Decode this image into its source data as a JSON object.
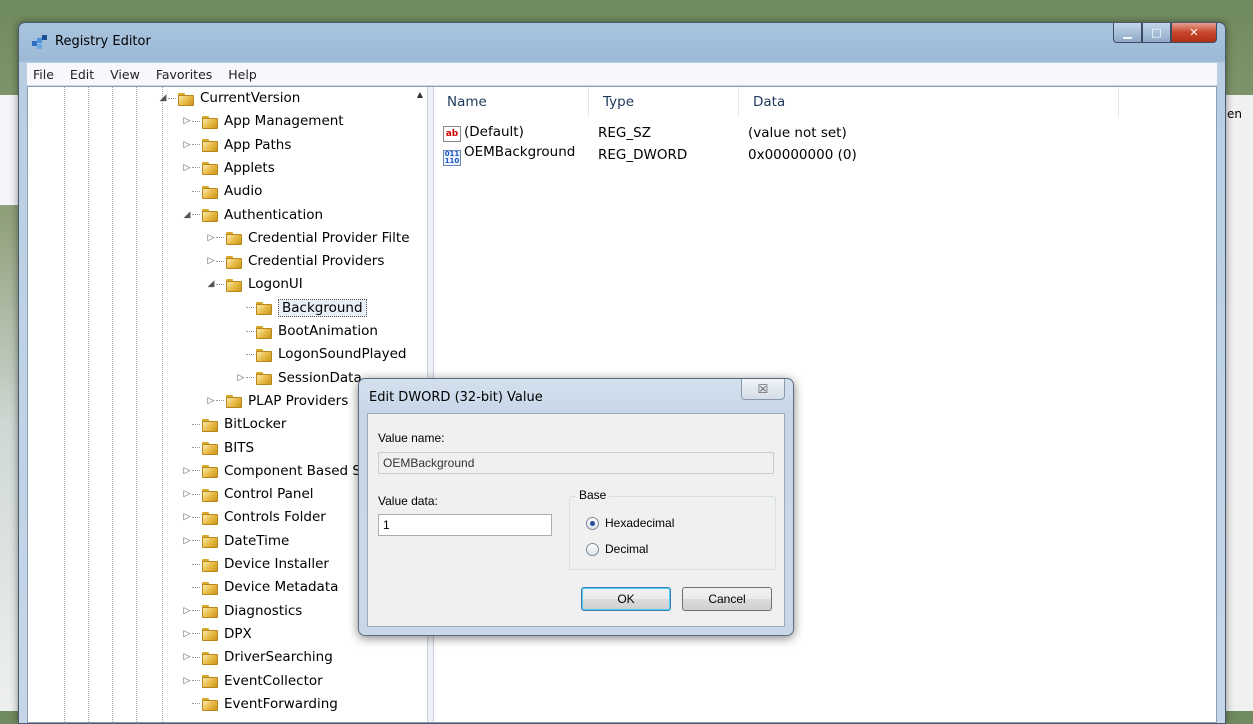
{
  "window": {
    "title": "Registry Editor"
  },
  "menu": [
    "File",
    "Edit",
    "View",
    "Favorites",
    "Help"
  ],
  "tree": [
    {
      "label": "CurrentVersion",
      "level": 0,
      "expander": "open"
    },
    {
      "label": "App Management",
      "level": 1,
      "expander": "closed"
    },
    {
      "label": "App Paths",
      "level": 1,
      "expander": "closed"
    },
    {
      "label": "Applets",
      "level": 1,
      "expander": "closed"
    },
    {
      "label": "Audio",
      "level": 1,
      "expander": "none"
    },
    {
      "label": "Authentication",
      "level": 1,
      "expander": "open"
    },
    {
      "label": "Credential Provider Filte",
      "level": 2,
      "expander": "closed"
    },
    {
      "label": "Credential Providers",
      "level": 2,
      "expander": "closed"
    },
    {
      "label": "LogonUI",
      "level": 2,
      "expander": "open"
    },
    {
      "label": "Background",
      "level": 3,
      "expander": "none",
      "selected": true
    },
    {
      "label": "BootAnimation",
      "level": 3,
      "expander": "none"
    },
    {
      "label": "LogonSoundPlayed",
      "level": 3,
      "expander": "none"
    },
    {
      "label": "SessionData",
      "level": 3,
      "expander": "closed"
    },
    {
      "label": "PLAP Providers",
      "level": 2,
      "expander": "closed"
    },
    {
      "label": "BitLocker",
      "level": 1,
      "expander": "none"
    },
    {
      "label": "BITS",
      "level": 1,
      "expander": "none"
    },
    {
      "label": "Component Based S",
      "level": 1,
      "expander": "closed"
    },
    {
      "label": "Control Panel",
      "level": 1,
      "expander": "closed"
    },
    {
      "label": "Controls Folder",
      "level": 1,
      "expander": "closed"
    },
    {
      "label": "DateTime",
      "level": 1,
      "expander": "closed"
    },
    {
      "label": "Device Installer",
      "level": 1,
      "expander": "none"
    },
    {
      "label": "Device Metadata",
      "level": 1,
      "expander": "none"
    },
    {
      "label": "Diagnostics",
      "level": 1,
      "expander": "closed"
    },
    {
      "label": "DPX",
      "level": 1,
      "expander": "closed"
    },
    {
      "label": "DriverSearching",
      "level": 1,
      "expander": "closed"
    },
    {
      "label": "EventCollector",
      "level": 1,
      "expander": "closed"
    },
    {
      "label": "EventForwarding",
      "level": 1,
      "expander": "none"
    }
  ],
  "list": {
    "columns": [
      "Name",
      "Type",
      "Data"
    ],
    "rows": [
      {
        "icon": "string-value-icon",
        "name": "(Default)",
        "type": "REG_SZ",
        "data": "(value not set)"
      },
      {
        "icon": "binary-value-icon",
        "name": "OEMBackground",
        "type": "REG_DWORD",
        "data": "0x00000000 (0)"
      }
    ]
  },
  "dialog": {
    "title": "Edit DWORD (32-bit) Value",
    "close_glyph": "☒",
    "value_name_label": "Value name:",
    "value_name": "OEMBackground",
    "value_data_label": "Value data:",
    "value_data": "1",
    "base_label": "Base",
    "hex_label": "Hexadecimal",
    "dec_label": "Decimal",
    "selected_base": "hex",
    "ok_label": "OK",
    "cancel_label": "Cancel"
  },
  "background_fragment": "en"
}
